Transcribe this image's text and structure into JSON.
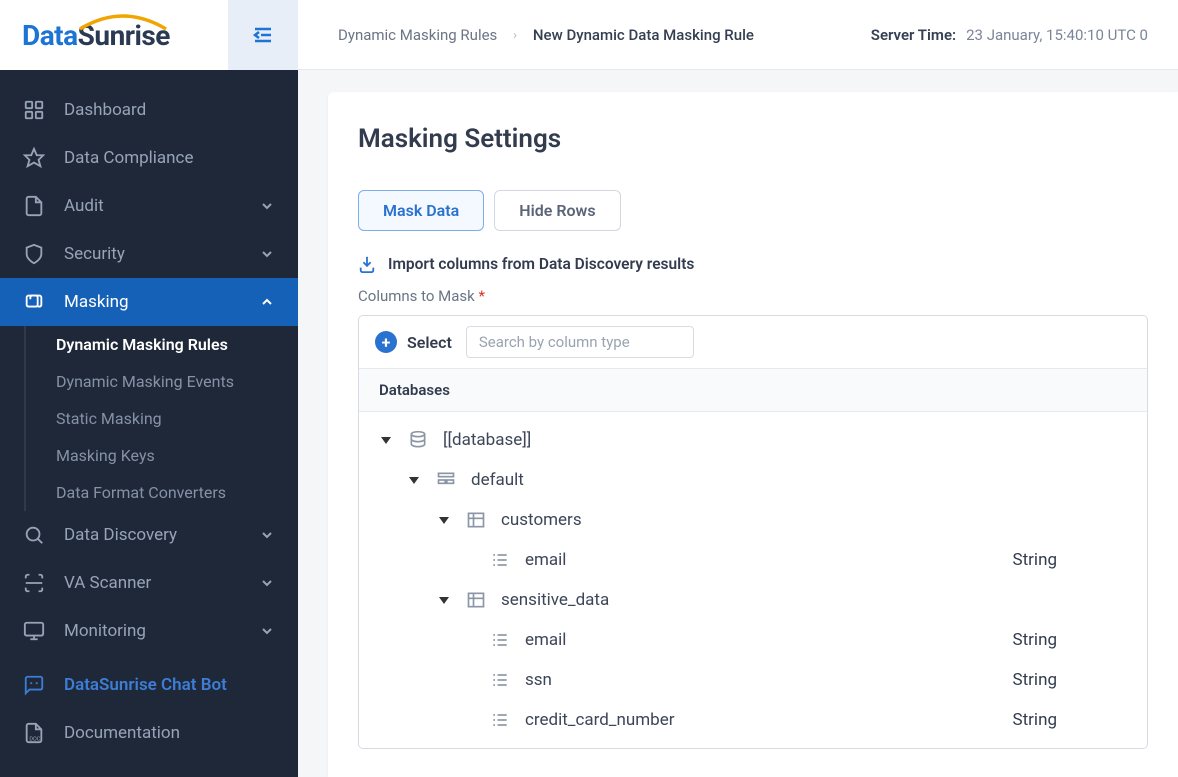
{
  "logo": {
    "part1": "Data",
    "part2": "Sunrise"
  },
  "breadcrumb": {
    "parent": "Dynamic Masking Rules",
    "current": "New Dynamic Data Masking Rule"
  },
  "server_time": {
    "label": "Server Time:",
    "value": "23 January, 15:40:10  UTC 0"
  },
  "sidebar": {
    "items": [
      {
        "label": "Dashboard"
      },
      {
        "label": "Data Compliance"
      },
      {
        "label": "Audit"
      },
      {
        "label": "Security"
      },
      {
        "label": "Masking"
      },
      {
        "label": "Data Discovery"
      },
      {
        "label": "VA Scanner"
      },
      {
        "label": "Monitoring"
      }
    ],
    "sub_masking": [
      {
        "label": "Dynamic Masking Rules"
      },
      {
        "label": "Dynamic Masking Events"
      },
      {
        "label": "Static Masking"
      },
      {
        "label": "Masking Keys"
      },
      {
        "label": "Data Format Converters"
      }
    ],
    "chatbot": "DataSunrise Chat Bot",
    "documentation": "Documentation"
  },
  "panel": {
    "title": "Masking Settings",
    "tabs": {
      "mask": "Mask Data",
      "hide": "Hide Rows"
    },
    "import_link": "Import columns from Data Discovery results",
    "field_label": "Columns to Mask",
    "select_label": "Select",
    "search_placeholder": "Search by column type",
    "db_header": "Databases",
    "tree": {
      "database": "[[database]]",
      "schema": "default",
      "tables": [
        {
          "name": "customers",
          "columns": [
            {
              "name": "email",
              "type": "String"
            }
          ]
        },
        {
          "name": "sensitive_data",
          "columns": [
            {
              "name": "email",
              "type": "String"
            },
            {
              "name": "ssn",
              "type": "String"
            },
            {
              "name": "credit_card_number",
              "type": "String"
            }
          ]
        }
      ]
    }
  }
}
